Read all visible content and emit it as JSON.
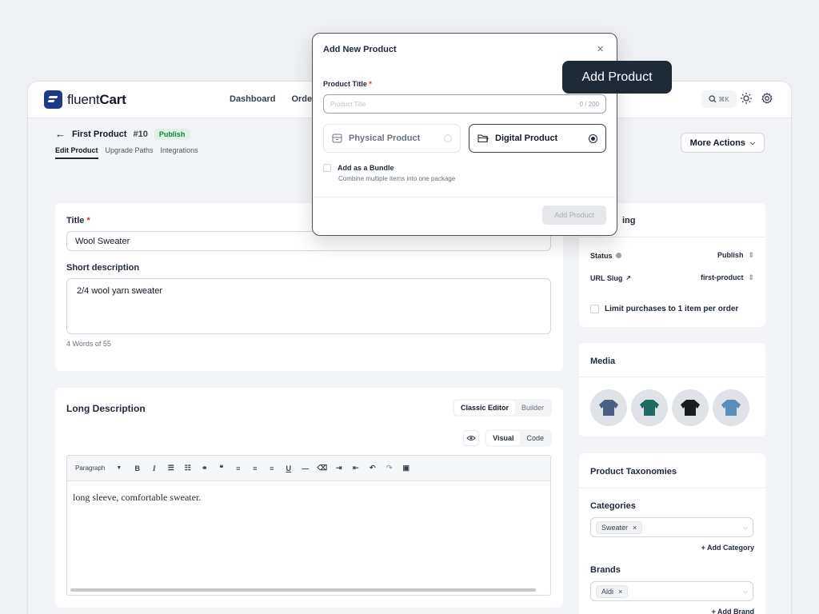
{
  "brand": {
    "name_light": "fluent",
    "name_bold": "Cart"
  },
  "nav": [
    "Dashboard",
    "Orders"
  ],
  "search_shortcut": "⌘K",
  "product": {
    "back_title": "First Product",
    "number": "#10",
    "status_badge": "Publish"
  },
  "subtabs": [
    "Edit Product",
    "Upgrade Paths",
    "Integrations"
  ],
  "more_actions": "More Actions",
  "form": {
    "title_label": "Title",
    "title_value": "Wool Sweater",
    "short_desc_label": "Short description",
    "short_desc_value": "2/4 wool yarn sweater",
    "word_count": "4 Words of 55"
  },
  "long_desc": {
    "title": "Long Description",
    "editor_tabs": [
      "Classic Editor",
      "Builder"
    ],
    "view_tabs": [
      "Visual",
      "Code"
    ],
    "paragraph_select": "Paragraph",
    "content": "long sleeve, comfortable sweater."
  },
  "pricing": {
    "title_partial": "ing",
    "status_label": "Status",
    "status_value": "Publish",
    "slug_label": "URL Slug",
    "slug_value": "first-product",
    "limit_label": "Limit purchases to 1 item per order"
  },
  "media": {
    "title": "Media"
  },
  "taxonomies": {
    "title": "Product Taxonomies",
    "categories_label": "Categories",
    "category_chip": "Sweater",
    "add_category": "+ Add Category",
    "brands_label": "Brands",
    "brand_chip": "Aldi",
    "add_brand": "+ Add Brand"
  },
  "modal": {
    "title": "Add New Product",
    "field_label": "Product Title",
    "placeholder": "Product Title",
    "counter": "0 / 200",
    "option_physical": "Physical Product",
    "option_digital": "Digital Product",
    "selected": "Digital Product",
    "bundle_label": "Add as a Bundle",
    "bundle_desc": "Combine multiple items into one package",
    "submit": "Add Product"
  },
  "tooltip": "Add Product",
  "colors": {
    "sweater_navy": "#4b5f86",
    "sweater_green": "#1f6b63",
    "sweater_black": "#1b1b1d",
    "sweater_blue": "#5a8db8"
  }
}
